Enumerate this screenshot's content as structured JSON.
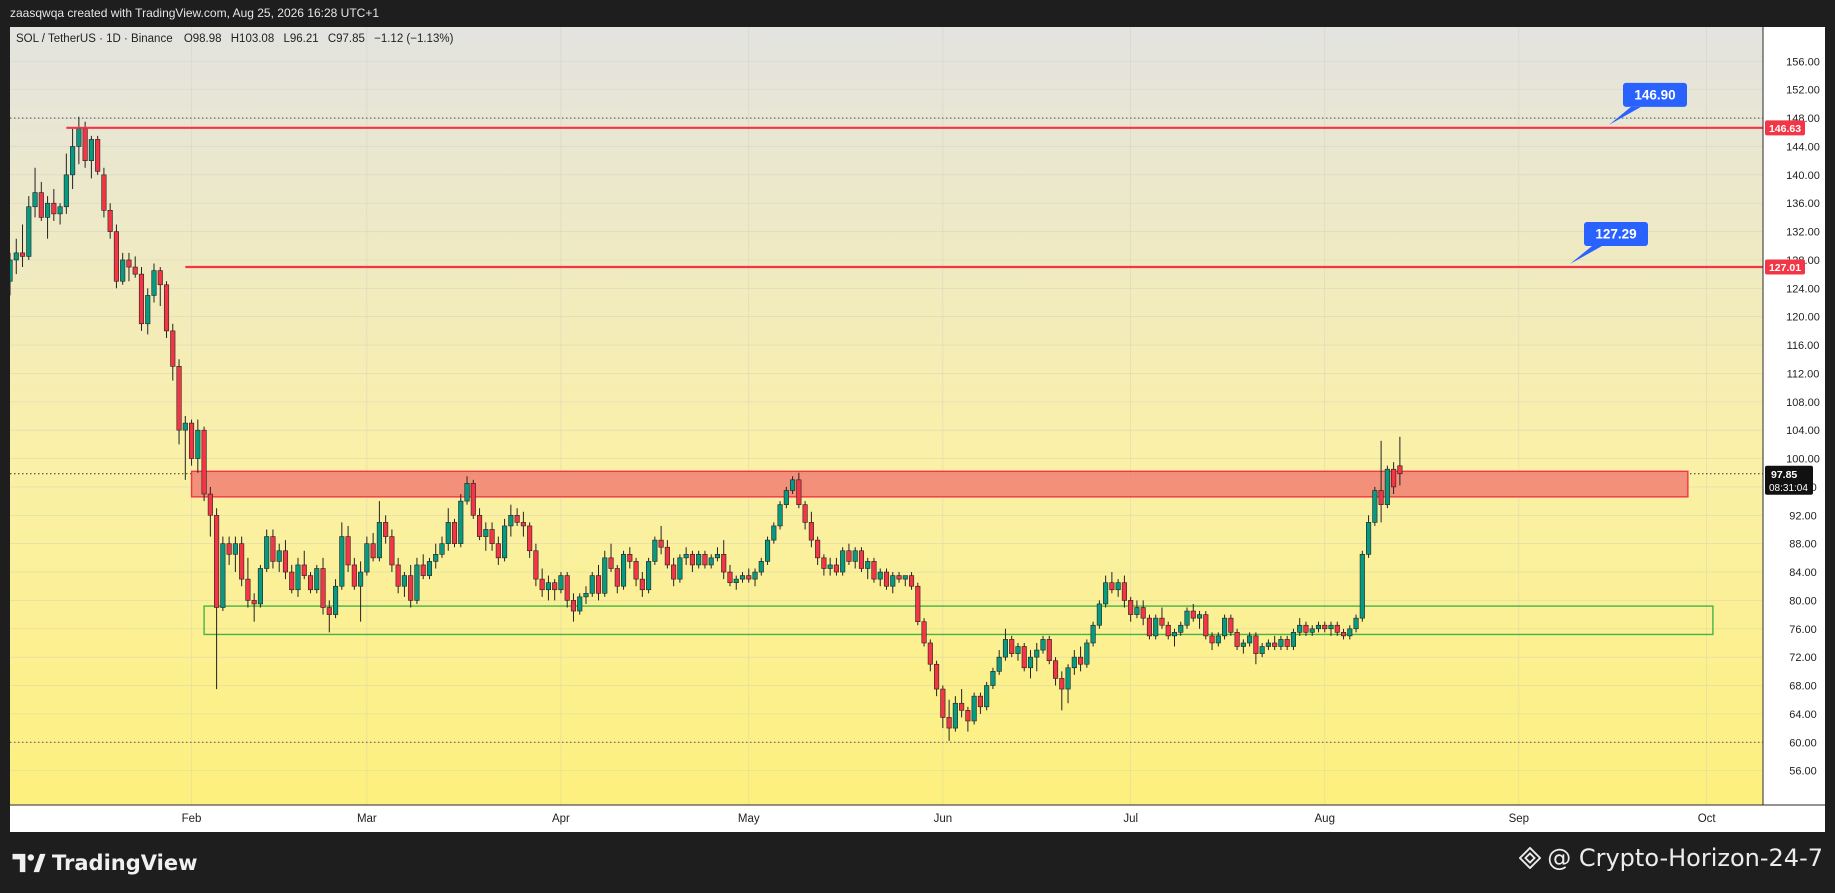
{
  "header": {
    "created_by": "zaasqwqa created with TradingView.com, Aug 25, 2026 16:28 UTC+1"
  },
  "footer": {
    "brand": "TradingView",
    "credit": "@ Crypto-Horizon-24-7"
  },
  "colors": {
    "bull": "#089981",
    "bear": "#f23645",
    "candle_border": "#222222",
    "resistance_line": "#f23645",
    "callout": "#2962ff",
    "red_zone": "#f28a78",
    "green_zone": "#44b543",
    "bg_top": "#e3e3e0",
    "bg_bottom": "#fdf07e"
  },
  "chart_data": {
    "type": "candlestick",
    "symbol_line": {
      "symbol": "SOL / TetherUS · 1D · Binance",
      "open": "O98.98",
      "high": "H103.08",
      "low": "L96.21",
      "close": "C97.85",
      "change": "−1.12 (−1.13%)"
    },
    "y_range": [
      52,
      160
    ],
    "y_ticks": [
      "156.00",
      "152.00",
      "148.00",
      "144.00",
      "140.00",
      "136.00",
      "132.00",
      "128.00",
      "124.00",
      "120.00",
      "116.00",
      "112.00",
      "108.00",
      "104.00",
      "100.00",
      "96.00",
      "92.00",
      "88.00",
      "84.00",
      "80.00",
      "76.00",
      "72.00",
      "68.00",
      "64.00",
      "60.00",
      "56.00"
    ],
    "x_labels": [
      {
        "label": "Feb",
        "date": "2026-02-01"
      },
      {
        "label": "Mar",
        "date": "2026-03-01"
      },
      {
        "label": "Apr",
        "date": "2026-04-01"
      },
      {
        "label": "May",
        "date": "2026-05-01"
      },
      {
        "label": "Jun",
        "date": "2026-06-01"
      },
      {
        "label": "Jul",
        "date": "2026-07-01"
      },
      {
        "label": "Aug",
        "date": "2026-08-01"
      },
      {
        "label": "Sep",
        "date": "2026-09-01"
      },
      {
        "label": "Oct",
        "date": "2026-10-01"
      }
    ],
    "x_range": [
      "2026-01-03",
      "2026-10-10"
    ],
    "first_date": "2026-01-03",
    "ohlc": [
      [
        125.0,
        129.0,
        123.0,
        128.0
      ],
      [
        128.0,
        131.0,
        126.0,
        129.0
      ],
      [
        129.0,
        133.0,
        127.0,
        128.5
      ],
      [
        128.5,
        137.0,
        128.0,
        135.5
      ],
      [
        135.5,
        141.0,
        134.0,
        137.5
      ],
      [
        137.5,
        139.0,
        133.5,
        134.0
      ],
      [
        134.0,
        137.0,
        131.0,
        136.0
      ],
      [
        136.0,
        138.0,
        133.5,
        134.5
      ],
      [
        134.5,
        136.0,
        133.0,
        135.5
      ],
      [
        135.5,
        143.0,
        134.5,
        140.0
      ],
      [
        140.0,
        146.5,
        138.0,
        144.0
      ],
      [
        144.0,
        148.2,
        141.5,
        146.5
      ],
      [
        146.5,
        147.5,
        141.0,
        142.0
      ],
      [
        142.0,
        145.5,
        139.5,
        145.0
      ],
      [
        145.0,
        145.5,
        140.0,
        140.5
      ],
      [
        140.0,
        141.0,
        134.0,
        135.0
      ],
      [
        135.0,
        136.0,
        131.0,
        132.0
      ],
      [
        132.0,
        133.0,
        124.0,
        125.0
      ],
      [
        125.0,
        129.0,
        124.5,
        128.0
      ],
      [
        128.0,
        129.0,
        125.0,
        127.0
      ],
      [
        127.0,
        128.5,
        125.5,
        126.0
      ],
      [
        126.0,
        127.0,
        118.0,
        119.0
      ],
      [
        119.0,
        124.0,
        117.5,
        123.0
      ],
      [
        123.0,
        127.5,
        122.0,
        126.5
      ],
      [
        126.5,
        127.0,
        121.5,
        124.5
      ],
      [
        124.5,
        125.0,
        117.0,
        118.0
      ],
      [
        118.0,
        119.0,
        111.0,
        113.0
      ],
      [
        113.0,
        114.0,
        102.0,
        104.0
      ],
      [
        104.0,
        106.0,
        97.0,
        105.0
      ],
      [
        105.0,
        105.5,
        99.0,
        100.0
      ],
      [
        100.0,
        105.5,
        98.0,
        104.0
      ],
      [
        104.0,
        104.5,
        94.0,
        95.0
      ],
      [
        95.0,
        96.0,
        89.0,
        92.0
      ],
      [
        92.0,
        93.0,
        67.5,
        79.0
      ],
      [
        79.0,
        89.0,
        78.5,
        88.0
      ],
      [
        88.0,
        89.0,
        85.0,
        86.5
      ],
      [
        86.5,
        89.0,
        84.0,
        88.0
      ],
      [
        88.0,
        89.0,
        82.0,
        83.0
      ],
      [
        83.0,
        86.0,
        79.0,
        80.0
      ],
      [
        80.0,
        81.0,
        77.0,
        79.5
      ],
      [
        79.5,
        85.0,
        79.0,
        84.5
      ],
      [
        84.5,
        90.0,
        84.0,
        89.0
      ],
      [
        89.0,
        90.0,
        84.5,
        85.5
      ],
      [
        85.5,
        88.0,
        84.0,
        87.0
      ],
      [
        87.0,
        88.5,
        83.0,
        84.0
      ],
      [
        84.0,
        85.0,
        81.0,
        81.5
      ],
      [
        81.5,
        86.0,
        80.5,
        85.0
      ],
      [
        85.0,
        87.0,
        83.0,
        83.5
      ],
      [
        83.5,
        84.0,
        81.0,
        81.5
      ],
      [
        81.5,
        85.0,
        81.0,
        84.5
      ],
      [
        84.5,
        86.0,
        78.0,
        79.0
      ],
      [
        79.0,
        80.0,
        75.5,
        78.0
      ],
      [
        78.0,
        83.0,
        77.5,
        82.0
      ],
      [
        82.0,
        91.0,
        81.5,
        89.0
      ],
      [
        89.0,
        90.5,
        84.0,
        85.0
      ],
      [
        85.0,
        86.0,
        81.5,
        82.0
      ],
      [
        82.0,
        85.5,
        77.0,
        84.0
      ],
      [
        84.0,
        89.0,
        83.5,
        88.0
      ],
      [
        88.0,
        89.5,
        85.5,
        86.0
      ],
      [
        86.0,
        94.0,
        85.5,
        91.0
      ],
      [
        91.0,
        92.0,
        88.0,
        89.0
      ],
      [
        89.0,
        90.0,
        84.0,
        85.0
      ],
      [
        85.0,
        86.0,
        81.0,
        82.0
      ],
      [
        82.0,
        84.0,
        80.5,
        83.5
      ],
      [
        83.5,
        85.0,
        79.0,
        80.0
      ],
      [
        80.0,
        86.0,
        79.5,
        85.0
      ],
      [
        85.0,
        86.5,
        83.0,
        83.5
      ],
      [
        83.5,
        86.0,
        83.0,
        85.5
      ],
      [
        85.5,
        88.0,
        84.5,
        86.5
      ],
      [
        86.5,
        89.0,
        86.0,
        88.0
      ],
      [
        88.0,
        93.0,
        87.0,
        91.0
      ],
      [
        91.0,
        91.5,
        87.5,
        88.0
      ],
      [
        88.0,
        95.0,
        87.5,
        94.0
      ],
      [
        94.0,
        97.5,
        93.5,
        96.5
      ],
      [
        96.5,
        97.0,
        91.5,
        92.0
      ],
      [
        92.0,
        93.0,
        88.5,
        89.0
      ],
      [
        89.0,
        91.0,
        87.0,
        90.0
      ],
      [
        90.0,
        91.0,
        87.0,
        88.0
      ],
      [
        88.0,
        89.0,
        85.0,
        86.0
      ],
      [
        86.0,
        91.5,
        85.5,
        90.5
      ],
      [
        90.5,
        93.5,
        89.0,
        92.0
      ],
      [
        92.0,
        93.0,
        90.5,
        91.0
      ],
      [
        91.0,
        92.5,
        89.0,
        90.5
      ],
      [
        90.5,
        91.0,
        86.0,
        87.0
      ],
      [
        87.0,
        88.0,
        82.0,
        83.0
      ],
      [
        83.0,
        84.5,
        80.5,
        81.5
      ],
      [
        81.5,
        83.5,
        80.0,
        82.5
      ],
      [
        82.5,
        83.0,
        80.0,
        81.5
      ],
      [
        81.5,
        84.0,
        81.0,
        83.5
      ],
      [
        83.5,
        84.0,
        79.0,
        80.0
      ],
      [
        80.0,
        81.0,
        77.0,
        78.5
      ],
      [
        78.5,
        81.0,
        78.0,
        80.5
      ],
      [
        80.5,
        82.0,
        79.5,
        81.0
      ],
      [
        81.0,
        84.0,
        80.5,
        83.5
      ],
      [
        83.5,
        85.0,
        80.0,
        81.0
      ],
      [
        81.0,
        87.0,
        80.5,
        86.0
      ],
      [
        86.0,
        88.0,
        84.0,
        84.5
      ],
      [
        84.5,
        85.0,
        81.0,
        82.0
      ],
      [
        82.0,
        87.0,
        81.5,
        86.5
      ],
      [
        86.5,
        87.5,
        84.5,
        85.5
      ],
      [
        85.5,
        86.0,
        82.0,
        83.0
      ],
      [
        83.0,
        84.0,
        80.5,
        81.5
      ],
      [
        81.5,
        86.0,
        81.0,
        85.5
      ],
      [
        85.5,
        89.0,
        85.0,
        88.5
      ],
      [
        88.5,
        90.5,
        86.5,
        87.5
      ],
      [
        87.5,
        88.5,
        84.5,
        85.0
      ],
      [
        85.0,
        86.0,
        82.0,
        83.0
      ],
      [
        83.0,
        86.5,
        82.5,
        86.0
      ],
      [
        86.0,
        87.5,
        85.0,
        86.5
      ],
      [
        86.5,
        87.0,
        84.0,
        85.0
      ],
      [
        85.0,
        87.0,
        84.5,
        86.5
      ],
      [
        86.5,
        87.0,
        84.5,
        85.0
      ],
      [
        85.0,
        86.5,
        84.5,
        86.0
      ],
      [
        86.0,
        87.5,
        85.5,
        86.5
      ],
      [
        86.5,
        88.5,
        83.0,
        84.0
      ],
      [
        84.0,
        85.0,
        82.0,
        82.5
      ],
      [
        82.5,
        83.5,
        81.5,
        83.0
      ],
      [
        83.0,
        84.0,
        82.5,
        83.5
      ],
      [
        83.5,
        84.5,
        82.5,
        83.0
      ],
      [
        83.0,
        84.5,
        82.0,
        84.0
      ],
      [
        84.0,
        86.0,
        83.5,
        85.5
      ],
      [
        85.5,
        89.0,
        85.0,
        88.5
      ],
      [
        88.5,
        91.0,
        88.0,
        90.5
      ],
      [
        90.5,
        94.0,
        90.0,
        93.5
      ],
      [
        93.5,
        96.0,
        93.0,
        95.5
      ],
      [
        95.5,
        97.5,
        95.0,
        97.0
      ],
      [
        97.0,
        98.0,
        93.0,
        93.5
      ],
      [
        93.5,
        94.0,
        90.0,
        91.0
      ],
      [
        91.0,
        92.5,
        87.5,
        88.5
      ],
      [
        88.5,
        89.0,
        85.0,
        86.0
      ],
      [
        86.0,
        86.5,
        83.5,
        84.5
      ],
      [
        84.5,
        86.0,
        83.5,
        85.0
      ],
      [
        85.0,
        86.0,
        83.5,
        84.0
      ],
      [
        84.0,
        87.5,
        83.5,
        87.0
      ],
      [
        87.0,
        88.0,
        85.0,
        85.5
      ],
      [
        85.5,
        87.5,
        84.5,
        87.0
      ],
      [
        87.0,
        87.5,
        84.0,
        84.5
      ],
      [
        84.5,
        86.0,
        83.0,
        85.5
      ],
      [
        85.5,
        86.0,
        82.5,
        83.0
      ],
      [
        83.0,
        84.5,
        82.0,
        84.0
      ],
      [
        84.0,
        84.5,
        81.5,
        82.0
      ],
      [
        82.0,
        84.0,
        81.0,
        83.5
      ],
      [
        83.5,
        84.0,
        82.5,
        83.0
      ],
      [
        83.0,
        83.5,
        82.0,
        83.5
      ],
      [
        83.5,
        84.0,
        81.5,
        82.0
      ],
      [
        82.0,
        82.5,
        76.5,
        77.0
      ],
      [
        77.0,
        77.5,
        73.5,
        74.0
      ],
      [
        74.0,
        74.5,
        70.0,
        71.0
      ],
      [
        71.0,
        71.5,
        66.5,
        67.5
      ],
      [
        67.5,
        68.0,
        62.0,
        63.5
      ],
      [
        63.5,
        66.0,
        60.2,
        62.0
      ],
      [
        62.0,
        66.5,
        61.5,
        65.5
      ],
      [
        65.5,
        67.5,
        63.5,
        64.5
      ],
      [
        64.5,
        65.0,
        61.5,
        63.0
      ],
      [
        63.0,
        67.0,
        62.5,
        66.5
      ],
      [
        66.5,
        67.0,
        64.0,
        65.0
      ],
      [
        65.0,
        68.5,
        64.5,
        68.0
      ],
      [
        68.0,
        70.5,
        67.5,
        70.0
      ],
      [
        70.0,
        73.0,
        69.5,
        72.0
      ],
      [
        72.0,
        76.0,
        71.5,
        74.5
      ],
      [
        74.5,
        75.0,
        72.0,
        72.5
      ],
      [
        72.5,
        74.0,
        71.5,
        73.5
      ],
      [
        73.5,
        74.0,
        70.0,
        70.5
      ],
      [
        70.5,
        73.0,
        69.0,
        72.0
      ],
      [
        72.0,
        74.0,
        70.0,
        73.0
      ],
      [
        73.0,
        75.0,
        72.5,
        74.5
      ],
      [
        74.5,
        75.0,
        71.0,
        71.5
      ],
      [
        71.5,
        72.0,
        68.0,
        69.0
      ],
      [
        69.0,
        70.0,
        64.5,
        67.5
      ],
      [
        67.5,
        71.0,
        65.5,
        70.5
      ],
      [
        70.5,
        73.0,
        69.5,
        72.0
      ],
      [
        72.0,
        73.5,
        70.0,
        71.0
      ],
      [
        71.0,
        74.5,
        70.5,
        74.0
      ],
      [
        74.0,
        77.0,
        73.5,
        76.5
      ],
      [
        76.5,
        80.0,
        76.0,
        79.5
      ],
      [
        79.5,
        83.5,
        79.0,
        82.5
      ],
      [
        82.5,
        84.0,
        81.0,
        81.5
      ],
      [
        81.5,
        83.0,
        80.5,
        82.5
      ],
      [
        82.5,
        83.5,
        79.0,
        80.0
      ],
      [
        80.0,
        80.5,
        77.0,
        78.0
      ],
      [
        78.0,
        80.0,
        77.5,
        79.0
      ],
      [
        79.0,
        80.0,
        76.5,
        77.5
      ],
      [
        77.5,
        78.0,
        74.5,
        75.0
      ],
      [
        75.0,
        78.0,
        74.5,
        77.5
      ],
      [
        77.5,
        79.0,
        76.0,
        76.5
      ],
      [
        76.5,
        77.0,
        74.5,
        75.0
      ],
      [
        75.0,
        76.0,
        73.5,
        75.5
      ],
      [
        75.5,
        77.0,
        75.0,
        76.5
      ],
      [
        76.5,
        79.0,
        76.0,
        78.5
      ],
      [
        78.5,
        79.5,
        77.0,
        77.5
      ],
      [
        77.5,
        78.5,
        76.0,
        78.0
      ],
      [
        78.0,
        78.5,
        74.5,
        75.0
      ],
      [
        75.0,
        75.5,
        73.0,
        74.0
      ],
      [
        74.0,
        75.5,
        73.5,
        75.0
      ],
      [
        75.0,
        78.0,
        74.5,
        77.5
      ],
      [
        77.5,
        78.0,
        75.0,
        75.5
      ],
      [
        75.5,
        76.0,
        73.0,
        73.5
      ],
      [
        73.5,
        74.5,
        72.5,
        74.0
      ],
      [
        74.0,
        75.5,
        73.5,
        75.0
      ],
      [
        75.0,
        75.5,
        71.0,
        72.5
      ],
      [
        72.5,
        74.0,
        72.0,
        73.5
      ],
      [
        73.5,
        74.5,
        73.0,
        74.0
      ],
      [
        74.0,
        75.0,
        73.0,
        73.5
      ],
      [
        73.5,
        75.0,
        73.0,
        74.5
      ],
      [
        74.5,
        75.0,
        73.0,
        73.5
      ],
      [
        73.5,
        76.0,
        73.0,
        75.5
      ],
      [
        75.5,
        77.5,
        75.0,
        76.5
      ],
      [
        76.5,
        77.0,
        75.0,
        75.5
      ],
      [
        75.5,
        76.5,
        75.0,
        76.0
      ],
      [
        76.0,
        77.0,
        75.5,
        76.5
      ],
      [
        76.5,
        77.0,
        75.5,
        76.0
      ],
      [
        76.0,
        77.0,
        75.0,
        76.5
      ],
      [
        76.5,
        77.0,
        75.0,
        75.5
      ],
      [
        75.5,
        76.0,
        74.5,
        75.0
      ],
      [
        75.0,
        76.5,
        74.5,
        76.0
      ],
      [
        76.0,
        78.0,
        75.5,
        77.5
      ],
      [
        77.5,
        87.0,
        77.0,
        86.5
      ],
      [
        86.5,
        92.0,
        86.0,
        91.0
      ],
      [
        91.0,
        96.0,
        90.5,
        95.5
      ],
      [
        95.5,
        102.5,
        91.0,
        93.5
      ],
      [
        93.5,
        99.0,
        93.0,
        98.5
      ],
      [
        98.5,
        99.5,
        95.0,
        96.0
      ],
      [
        98.98,
        103.08,
        96.21,
        97.85
      ]
    ],
    "horizontal_lines": [
      {
        "price": 146.63,
        "label": "146.63",
        "from_date": "2026-01-12"
      },
      {
        "price": 127.01,
        "label": "127.01",
        "from_date": "2026-01-31"
      }
    ],
    "callouts": [
      {
        "text": "146.90",
        "price": 146.9
      },
      {
        "text": "127.29",
        "price": 127.29
      }
    ],
    "zones": [
      {
        "name": "red-resistance-zone",
        "top": 98.2,
        "bottom": 94.6,
        "from_date": "2026-02-01",
        "to_date": "2026-09-28"
      },
      {
        "name": "green-support-zone",
        "top": 79.2,
        "bottom": 75.2,
        "from_date": "2026-02-03",
        "to_date": "2026-10-02"
      }
    ],
    "dotted_levels": [
      148.0,
      60.0
    ],
    "last_price": {
      "value": 97.85,
      "label": "97.85",
      "countdown": "08:31:04"
    }
  }
}
